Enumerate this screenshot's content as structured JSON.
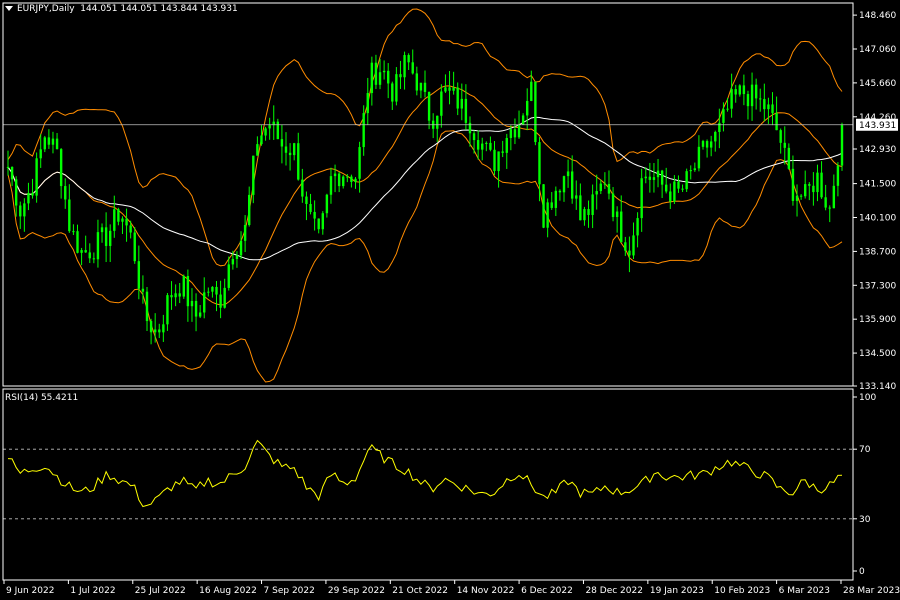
{
  "header": {
    "symbol": "EURJPY,Daily",
    "ohlc": "144.051 144.051 143.844 143.931"
  },
  "price_axis": {
    "ticks": [
      "148.460",
      "147.060",
      "145.660",
      "144.260",
      "142.930",
      "141.500",
      "140.100",
      "138.700",
      "137.300",
      "135.900",
      "134.500",
      "133.140"
    ],
    "current_price_label": "143.931"
  },
  "rsi": {
    "label": "RSI(14) 55.4211",
    "ticks": [
      "100",
      "70",
      "30",
      "0"
    ]
  },
  "x_axis": {
    "ticks": [
      "9 Jun 2022",
      "1 Jul 2022",
      "25 Jul 2022",
      "16 Aug 2022",
      "7 Sep 2022",
      "29 Sep 2022",
      "21 Oct 2022",
      "14 Nov 2022",
      "6 Dec 2022",
      "28 Dec 2022",
      "19 Jan 2023",
      "10 Feb 2023",
      "6 Mar 2023",
      "28 Mar 2023"
    ]
  },
  "colors": {
    "background": "#000000",
    "candles": "#00ff00",
    "bollinger": "#ff8c00",
    "moving_average": "#ffffff",
    "rsi_line": "#ffff00",
    "current_price_line": "#c0c0c0",
    "axis": "#ffffff"
  },
  "chart_data": [
    {
      "type": "candlestick",
      "title": "EURJPY,Daily",
      "ylim": [
        133.14,
        148.96
      ],
      "indicators": [
        "Bollinger Bands",
        "Moving Average"
      ],
      "close_path": [
        {
          "x": "9 Jun 2022",
          "y": 142.2
        },
        {
          "x": "14 Jun 2022",
          "y": 140.4
        },
        {
          "x": "17 Jun 2022",
          "y": 141.5
        },
        {
          "x": "22 Jun 2022",
          "y": 143.6
        },
        {
          "x": "27 Jun 2022",
          "y": 142.7
        },
        {
          "x": "1 Jul 2022",
          "y": 139.6
        },
        {
          "x": "6 Jul 2022",
          "y": 138.6
        },
        {
          "x": "11 Jul 2022",
          "y": 138.9
        },
        {
          "x": "15 Jul 2022",
          "y": 139.4
        },
        {
          "x": "20 Jul 2022",
          "y": 140.4
        },
        {
          "x": "25 Jul 2022",
          "y": 139.1
        },
        {
          "x": "29 Jul 2022",
          "y": 136.0
        },
        {
          "x": "3 Aug 2022",
          "y": 135.3
        },
        {
          "x": "8 Aug 2022",
          "y": 136.9
        },
        {
          "x": "11 Aug 2022",
          "y": 137.4
        },
        {
          "x": "16 Aug 2022",
          "y": 135.9
        },
        {
          "x": "19 Aug 2022",
          "y": 137.2
        },
        {
          "x": "24 Aug 2022",
          "y": 136.6
        },
        {
          "x": "29 Aug 2022",
          "y": 138.8
        },
        {
          "x": "2 Sep 2022",
          "y": 139.4
        },
        {
          "x": "7 Sep 2022",
          "y": 143.3
        },
        {
          "x": "12 Sep 2022",
          "y": 144.0
        },
        {
          "x": "15 Sep 2022",
          "y": 143.1
        },
        {
          "x": "20 Sep 2022",
          "y": 142.9
        },
        {
          "x": "23 Sep 2022",
          "y": 140.3
        },
        {
          "x": "29 Sep 2022",
          "y": 139.1
        },
        {
          "x": "4 Oct 2022",
          "y": 141.8
        },
        {
          "x": "7 Oct 2022",
          "y": 142.0
        },
        {
          "x": "12 Oct 2022",
          "y": 141.8
        },
        {
          "x": "17 Oct 2022",
          "y": 145.9
        },
        {
          "x": "21 Oct 2022",
          "y": 146.3
        },
        {
          "x": "26 Oct 2022",
          "y": 145.2
        },
        {
          "x": "31 Oct 2022",
          "y": 146.6
        },
        {
          "x": "3 Nov 2022",
          "y": 145.6
        },
        {
          "x": "9 Nov 2022",
          "y": 144.1
        },
        {
          "x": "14 Nov 2022",
          "y": 145.3
        },
        {
          "x": "18 Nov 2022",
          "y": 145.0
        },
        {
          "x": "23 Nov 2022",
          "y": 144.2
        },
        {
          "x": "28 Nov 2022",
          "y": 143.2
        },
        {
          "x": "1 Dec 2022",
          "y": 142.3
        },
        {
          "x": "6 Dec 2022",
          "y": 143.6
        },
        {
          "x": "9 Dec 2022",
          "y": 144.0
        },
        {
          "x": "15 Dec 2022",
          "y": 145.6
        },
        {
          "x": "20 Dec 2022",
          "y": 140.2
        },
        {
          "x": "23 Dec 2022",
          "y": 141.3
        },
        {
          "x": "28 Dec 2022",
          "y": 142.1
        },
        {
          "x": "3 Jan 2023",
          "y": 140.0
        },
        {
          "x": "6 Jan 2023",
          "y": 140.6
        },
        {
          "x": "11 Jan 2023",
          "y": 141.8
        },
        {
          "x": "16 Jan 2023",
          "y": 139.8
        },
        {
          "x": "19 Jan 2023",
          "y": 138.8
        },
        {
          "x": "24 Jan 2023",
          "y": 141.9
        },
        {
          "x": "27 Jan 2023",
          "y": 141.7
        },
        {
          "x": "1 Feb 2023",
          "y": 141.2
        },
        {
          "x": "6 Feb 2023",
          "y": 141.1
        },
        {
          "x": "10 Feb 2023",
          "y": 142.0
        },
        {
          "x": "15 Feb 2023",
          "y": 143.0
        },
        {
          "x": "20 Feb 2023",
          "y": 143.5
        },
        {
          "x": "23 Feb 2023",
          "y": 144.8
        },
        {
          "x": "28 Feb 2023",
          "y": 145.3
        },
        {
          "x": "3 Mar 2023",
          "y": 145.0
        },
        {
          "x": "6 Mar 2023",
          "y": 144.6
        },
        {
          "x": "9 Mar 2023",
          "y": 143.4
        },
        {
          "x": "14 Mar 2023",
          "y": 141.3
        },
        {
          "x": "17 Mar 2023",
          "y": 140.9
        },
        {
          "x": "22 Mar 2023",
          "y": 141.8
        },
        {
          "x": "24 Mar 2023",
          "y": 140.4
        },
        {
          "x": "28 Mar 2023",
          "y": 143.931
        }
      ]
    },
    {
      "type": "line",
      "title": "RSI(14) 55.4211",
      "ylim": [
        0,
        100
      ],
      "levels": [
        70,
        30
      ],
      "series": [
        {
          "name": "RSI(14)",
          "values": [
            65,
            56,
            59,
            61,
            54,
            48,
            45,
            49,
            56,
            52,
            49,
            37,
            41,
            48,
            52,
            46,
            52,
            50,
            55,
            60,
            74,
            66,
            60,
            59,
            48,
            43,
            56,
            50,
            54,
            71,
            66,
            61,
            58,
            52,
            47,
            53,
            50,
            47,
            44,
            45,
            52,
            57,
            50,
            42,
            45,
            52,
            45,
            44,
            49,
            45,
            47,
            50,
            57,
            54,
            54,
            55,
            56,
            60,
            63,
            60,
            57,
            54,
            47,
            45,
            52,
            47,
            49,
            55
          ]
        }
      ]
    }
  ]
}
